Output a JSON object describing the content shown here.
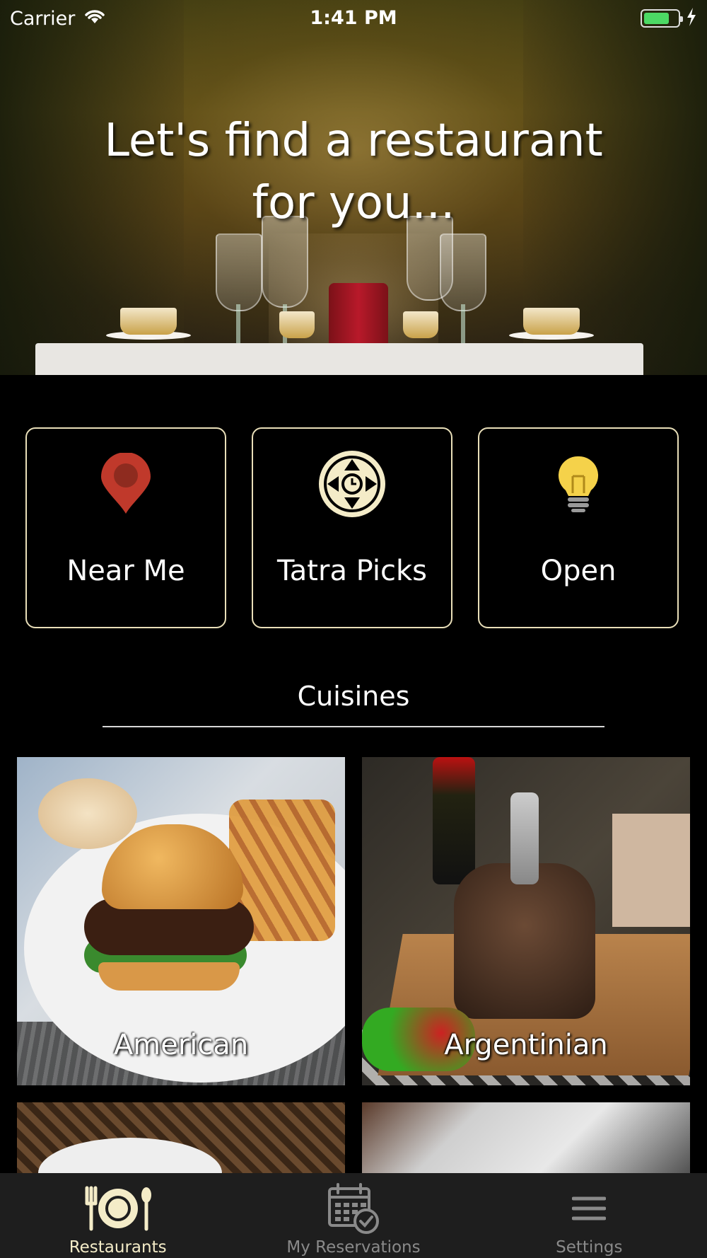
{
  "status_bar": {
    "carrier": "Carrier",
    "time": "1:41 PM",
    "battery_level": 0.75
  },
  "hero": {
    "title": "Let's find a restaurant\nfor you..."
  },
  "quick_actions": [
    {
      "label": "Near Me",
      "icon": "map-pin-icon"
    },
    {
      "label": "Tatra Picks",
      "icon": "compass-clock-icon"
    },
    {
      "label": "Open",
      "icon": "lightbulb-icon"
    }
  ],
  "cuisines": {
    "title": "Cuisines",
    "items": [
      {
        "label": "American"
      },
      {
        "label": "Argentinian"
      }
    ]
  },
  "tab_bar": {
    "tabs": [
      {
        "label": "Restaurants",
        "icon": "plate-cutlery-icon",
        "active": true
      },
      {
        "label": "My Reservations",
        "icon": "calendar-check-icon",
        "active": false
      },
      {
        "label": "Settings",
        "icon": "hamburger-menu-icon",
        "active": false
      }
    ]
  },
  "colors": {
    "accent": "#f4ecc8",
    "card_border": "#e9dfb9",
    "pin": "#c0392b",
    "bulb": "#f5d24a",
    "tab_bar_bg": "#1e1e1e",
    "inactive_tab": "#8a8a8a"
  }
}
